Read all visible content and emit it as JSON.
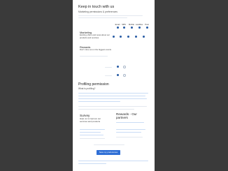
{
  "header": {
    "title": "Keep in touch with us",
    "subtitle": "Marketing permissions & preferences"
  },
  "channels": [
    "Email",
    "SMS",
    "Mobile",
    "Landline",
    "Post"
  ],
  "preferences": [
    {
      "title": "Marketing",
      "desc": "Exciting offers and news about our products and services"
    },
    {
      "title": "Rewards",
      "desc": "Don't miss out on the biggest events"
    }
  ],
  "colors": {
    "accent": "#2b5ea6",
    "button": "#2f6fd6",
    "backdrop": "#3a3a3a"
  },
  "profiling": {
    "title": "Profiling permission",
    "subtitle": "What is profiling?"
  },
  "cards": [
    {
      "title": "Survey",
      "desc": "Help us to improve our services and products"
    },
    {
      "title": "Rewards - Our partners",
      "desc": ""
    }
  ],
  "footer": {
    "button_label": "Save my preferences"
  }
}
